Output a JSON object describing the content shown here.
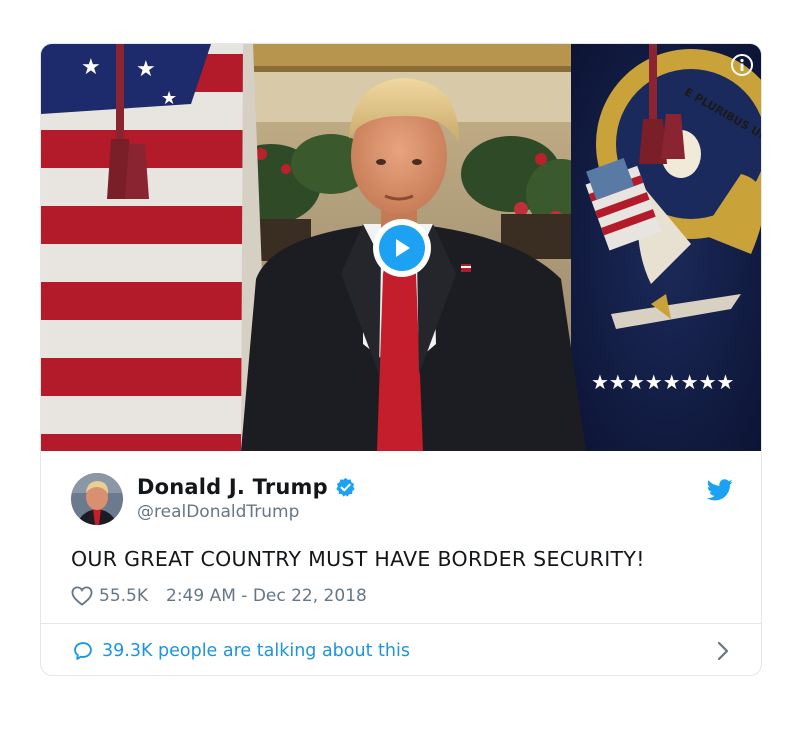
{
  "tweet": {
    "display_name": "Donald J. Trump",
    "handle": "@realDonaldTrump",
    "text": "OUR GREAT COUNTRY MUST HAVE BORDER SECURITY!",
    "like_count": "55.5K",
    "timestamp": "2:49 AM - Dec 22, 2018",
    "conversation_label": "39.3K people are talking about this"
  },
  "media": {
    "seal_text": "E PLURIBUS UNUM"
  },
  "icons": {
    "play": "play-icon",
    "info": "info-icon",
    "verified": "verified-badge-icon",
    "twitter": "twitter-bird-icon",
    "heart": "heart-icon",
    "reply": "reply-bubble-icon",
    "chevron": "chevron-right-icon"
  },
  "colors": {
    "accent": "#1da1f2",
    "link": "#1b95e0",
    "text": "#14171a",
    "muted": "#657786",
    "border": "#e1e8ed"
  }
}
